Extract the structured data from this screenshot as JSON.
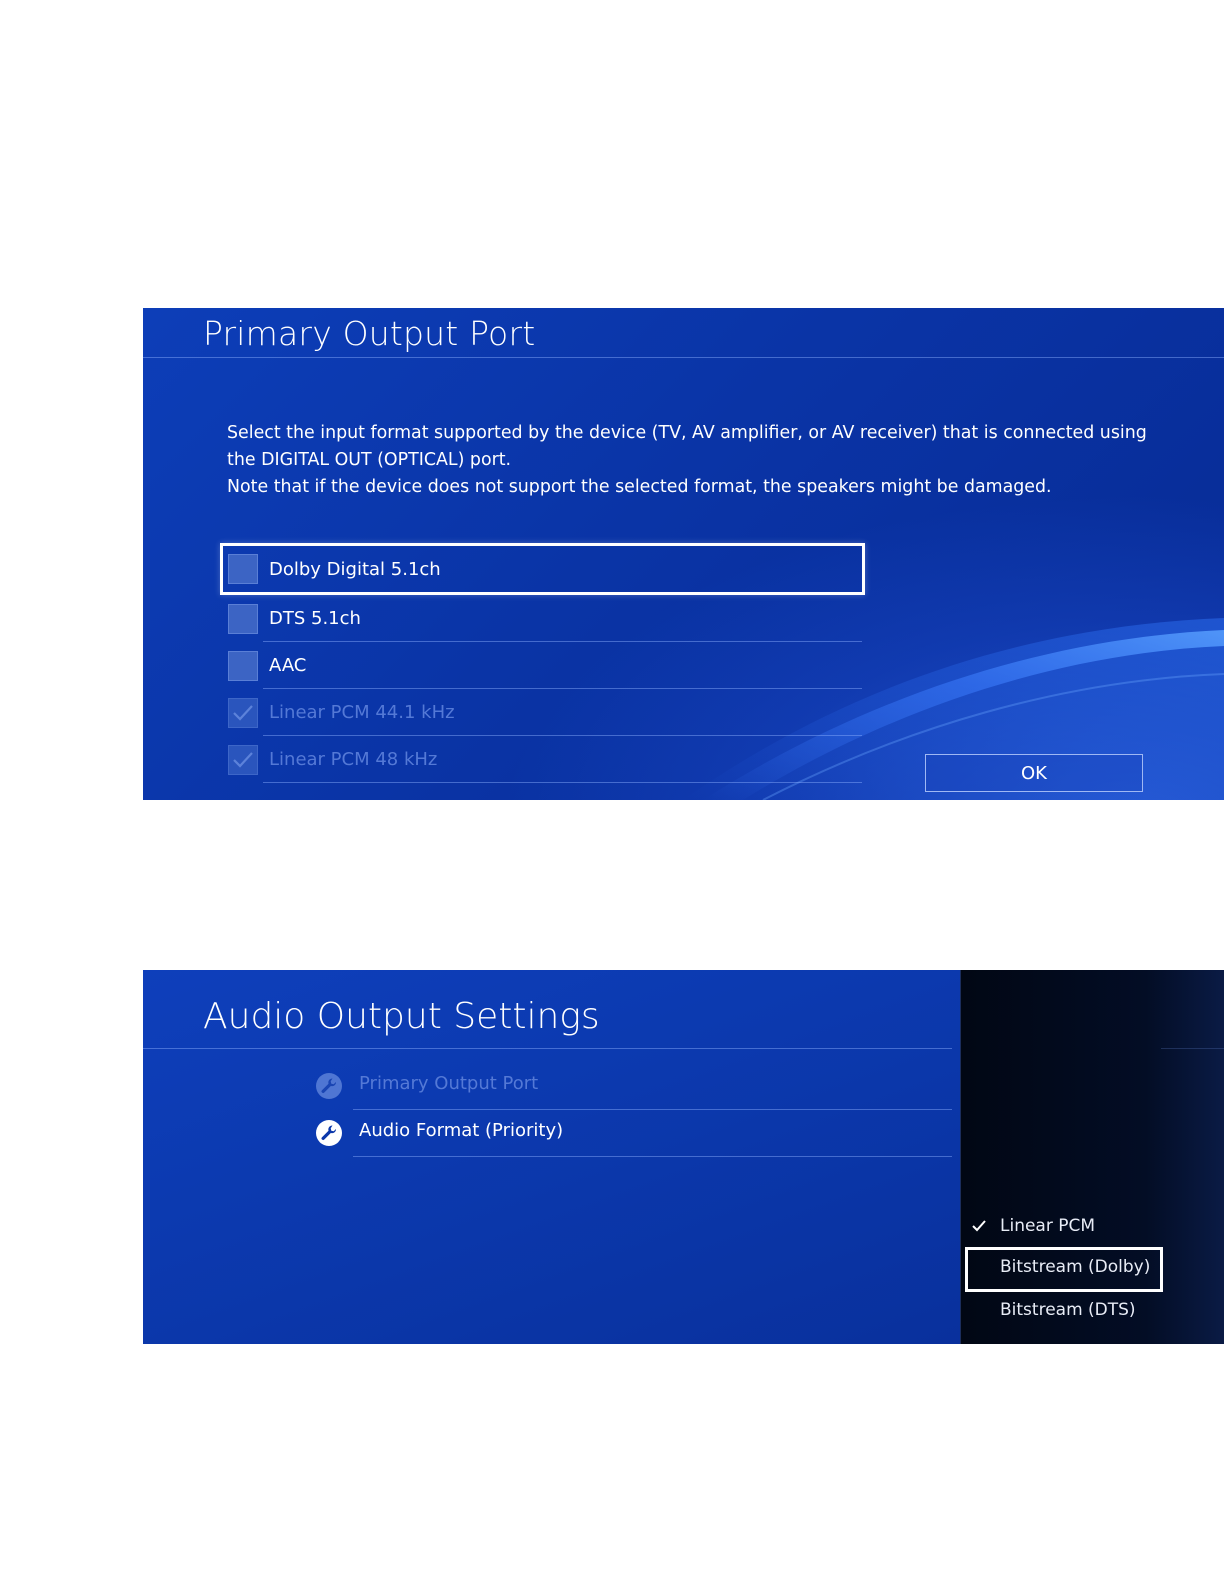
{
  "primary_output_port": {
    "title": "Primary Output Port",
    "description_line1": "Select the input format supported by the device (TV, AV amplifier, or AV receiver) that is connected using the DIGITAL OUT (OPTICAL) port.",
    "description_line2": "Note that if the device does not support the selected format, the speakers might be damaged.",
    "options": [
      {
        "label": "Dolby Digital 5.1ch",
        "checked": false,
        "enabled": true,
        "focused": true
      },
      {
        "label": "DTS 5.1ch",
        "checked": false,
        "enabled": true,
        "focused": false
      },
      {
        "label": "AAC",
        "checked": false,
        "enabled": true,
        "focused": false
      },
      {
        "label": "Linear PCM 44.1 kHz",
        "checked": true,
        "enabled": false,
        "focused": false
      },
      {
        "label": "Linear PCM 48 kHz",
        "checked": true,
        "enabled": false,
        "focused": false
      }
    ],
    "ok_label": "OK"
  },
  "audio_output_settings": {
    "title": "Audio Output Settings",
    "menu_items": [
      {
        "label": "Primary Output Port",
        "enabled": false,
        "icon": "wrench-icon"
      },
      {
        "label": "Audio Format (Priority)",
        "enabled": true,
        "icon": "wrench-icon"
      }
    ],
    "dropdown": {
      "options": [
        {
          "label": "Linear PCM",
          "selected": true,
          "focused": false
        },
        {
          "label": "Bitstream (Dolby)",
          "selected": false,
          "focused": true
        },
        {
          "label": "Bitstream (DTS)",
          "selected": false,
          "focused": false
        }
      ]
    }
  },
  "colors": {
    "panel_blue": "#0b37aa",
    "dropdown_bg": "#030d25",
    "disabled_text": "#5479d6",
    "focus_border": "#ffffff"
  }
}
